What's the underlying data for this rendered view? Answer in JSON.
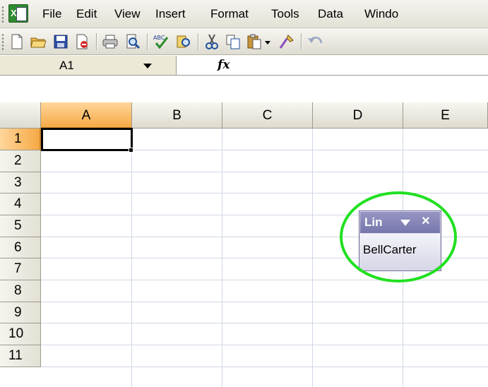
{
  "menubar": {
    "items": [
      "File",
      "Edit",
      "View",
      "Insert",
      "Format",
      "Tools",
      "Data",
      "Windo"
    ]
  },
  "toolbar": {
    "buttons": [
      "new-icon",
      "open-icon",
      "save-icon",
      "permission-icon",
      "print-icon",
      "print-preview-icon",
      "spelling-icon",
      "research-icon",
      "cut-icon",
      "copy-icon",
      "paste-icon",
      "paste-dropdown-icon",
      "format-painter-icon",
      "undo-icon"
    ]
  },
  "formula_bar": {
    "name_box": "A1",
    "fx_label": "fx",
    "formula": ""
  },
  "grid": {
    "columns": [
      "A",
      "B",
      "C",
      "D",
      "E"
    ],
    "rows": [
      "1",
      "2",
      "3",
      "4",
      "5",
      "6",
      "7",
      "8",
      "9",
      "10",
      "11"
    ],
    "active_cell": "A1"
  },
  "floating_toolbar": {
    "title": "Lin",
    "close": "×",
    "item": "BellCarter"
  },
  "colors": {
    "highlight_ring": "#22e022",
    "active_header": "#f6a945",
    "floating_title": "#7877ad"
  }
}
